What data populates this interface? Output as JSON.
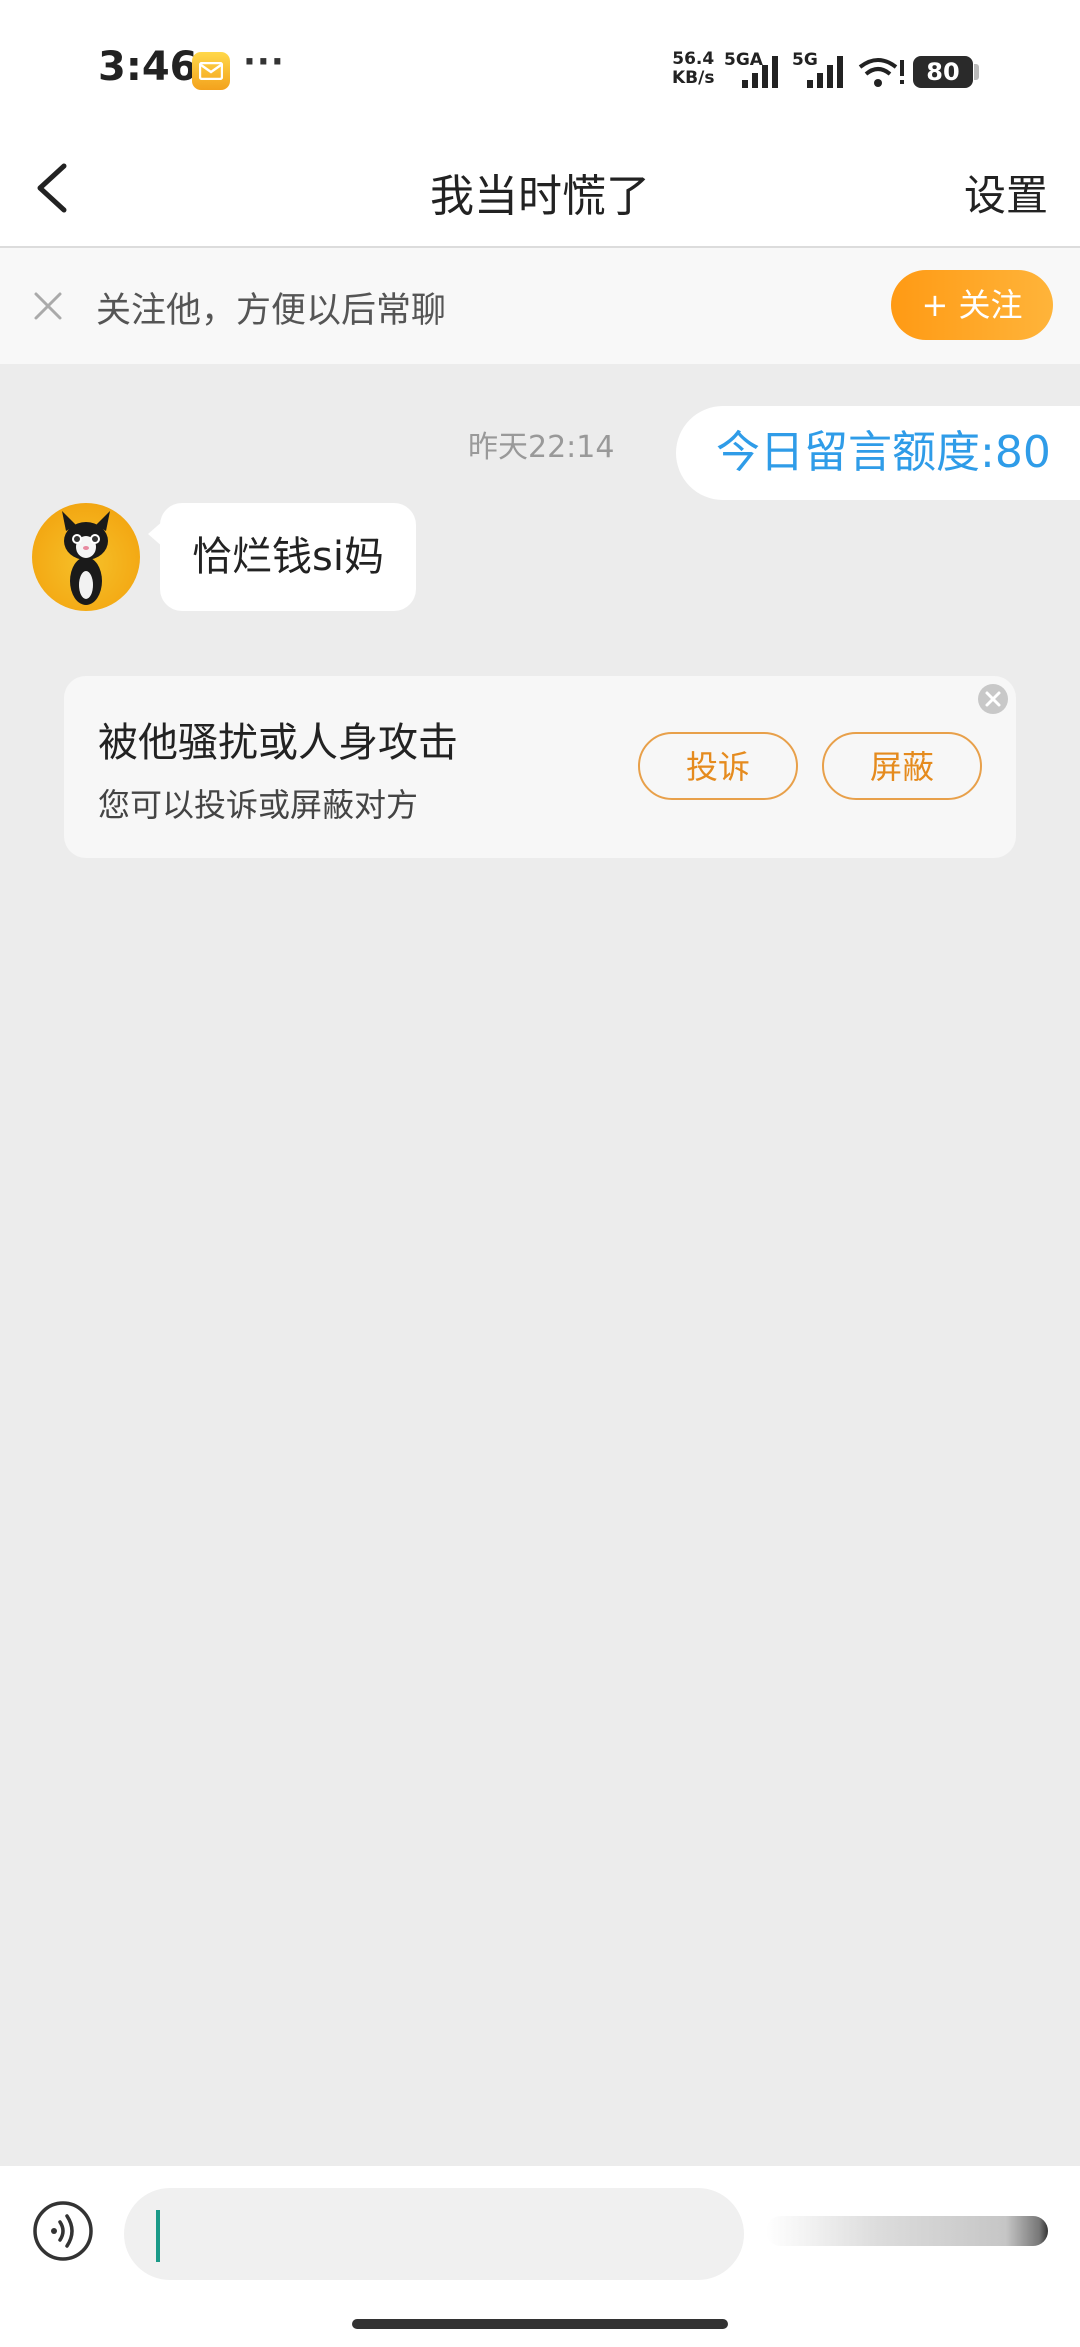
{
  "status_bar": {
    "time": "3:46",
    "more": "···",
    "speed_value": "56.4",
    "speed_unit": "KB/s",
    "network_1": "5GA",
    "network_2": "5G",
    "battery": "80",
    "mail_icon": "mail-icon",
    "wifi_icon": "wifi-icon"
  },
  "header": {
    "title": "我当时慌了",
    "settings_label": "设置",
    "back_icon": "chevron-left-icon"
  },
  "follow_banner": {
    "text": "关注他，方便以后常聊",
    "button_label": "+ 关注",
    "close_icon": "close-icon"
  },
  "chat": {
    "timestamp": "昨天22:14",
    "quota_text": "今日留言额度:80",
    "incoming_message": "恰烂钱si妈"
  },
  "report_card": {
    "title": "被他骚扰或人身攻击",
    "subtitle": "您可以投诉或屏蔽对方",
    "complain_label": "投诉",
    "block_label": "屏蔽"
  },
  "input_bar": {
    "value": "",
    "voice_icon": "voice-icon"
  },
  "colors": {
    "accent_orange": "#ff9a14",
    "link_blue": "#2f9ce8",
    "background": "#ececec"
  }
}
